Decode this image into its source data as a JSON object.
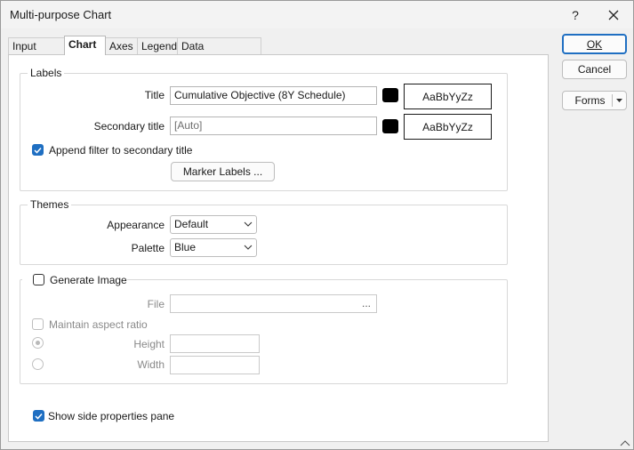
{
  "window": {
    "title": "Multi-purpose Chart",
    "help_label": "?",
    "close_label": "✕"
  },
  "tabs": [
    {
      "label": "Input Data",
      "active": false
    },
    {
      "label": "Chart",
      "active": true
    },
    {
      "label": "Axes",
      "active": false
    },
    {
      "label": "Legend",
      "active": false
    },
    {
      "label": "Data Annotations",
      "active": false
    }
  ],
  "labels_group": {
    "heading": "Labels",
    "title_label": "Title",
    "title_value": "Cumulative Objective (8Y Schedule)",
    "title_font_sample": "AaBbYyZz",
    "secondary_title_label": "Secondary title",
    "secondary_title_placeholder": "[Auto]",
    "secondary_font_sample": "AaBbYyZz",
    "append_filter_label": "Append filter to secondary title",
    "append_filter_checked": true,
    "marker_labels_button": "Marker Labels ..."
  },
  "themes_group": {
    "heading": "Themes",
    "appearance_label": "Appearance",
    "appearance_value": "Default",
    "palette_label": "Palette",
    "palette_value": "Blue"
  },
  "image_group": {
    "generate_label": "Generate Image",
    "generate_checked": false,
    "file_label": "File",
    "file_browse": "...",
    "aspect_label": "Maintain aspect ratio",
    "height_label": "Height",
    "width_label": "Width"
  },
  "show_side_pane_label": "Show side properties pane",
  "show_side_pane_checked": true,
  "buttons": {
    "ok": "OK",
    "cancel": "Cancel",
    "forms": "Forms"
  },
  "colors": {
    "accent": "#1f6fc2",
    "swatch": "#000000"
  }
}
